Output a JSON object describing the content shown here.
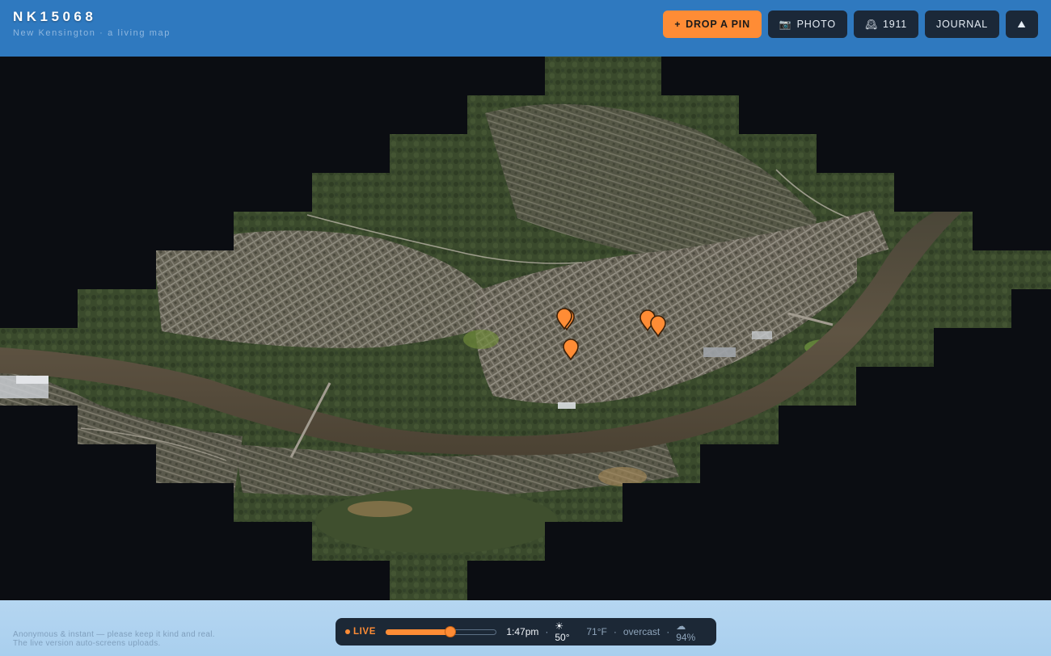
{
  "header": {
    "title": "NK15068",
    "subtitle": "New Kensington · a living map",
    "buttons": {
      "drop_pin": {
        "icon": "plus-icon",
        "glyph": "+",
        "label": "DROP A PIN"
      },
      "photo": {
        "icon": "camera-icon",
        "glyph": "📷",
        "label": "PHOTO"
      },
      "year": {
        "icon": "historic-map-icon",
        "glyph": "🕰",
        "label": "1911"
      },
      "journal": {
        "label": "JOURNAL"
      },
      "layers": {
        "icon": "satellite-layers-icon",
        "glyph": "⛰"
      }
    }
  },
  "map": {
    "view": "satellite",
    "pins": [
      {
        "id": "pin-1"
      },
      {
        "id": "pin-2"
      },
      {
        "id": "pin-3"
      },
      {
        "id": "pin-4"
      },
      {
        "id": "pin-5"
      }
    ],
    "colors": {
      "pin": "#ff8c35",
      "pin_border": "#3a1f08",
      "river": "#5a4e3e",
      "void": "#0b0d12"
    }
  },
  "footer": {
    "disclaimer": "Anonymous & instant — please keep it kind and real. The live version auto-screens uploads.",
    "live_bar": {
      "live_label": "LIVE",
      "time_value": 0.58,
      "time": "1:47pm",
      "sun": "☀ 50°",
      "temperature": "71°F",
      "condition": "overcast",
      "cloud": "☁ 94%"
    }
  },
  "colors": {
    "header_bg": "#2f79bf",
    "accent": "#ff8c35",
    "button_bg": "#1b2838",
    "footer_bg": "#b0d2ef"
  }
}
